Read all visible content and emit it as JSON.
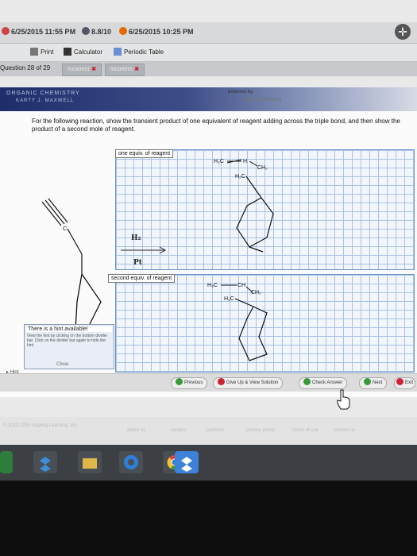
{
  "tabs": {
    "first_date": "6/25/2015 11:55 PM",
    "middle": "8.8/10",
    "second_date": "6/25/2015 10:25 PM"
  },
  "toolbar": {
    "print": "Print",
    "calculator": "Calculator",
    "periodic_table": "Periodic Table"
  },
  "question": {
    "number": "Question 28 of 29",
    "tab_incorrect_1": "Incorrect",
    "tab_incorrect_2": "Incorrect"
  },
  "header": {
    "course_line1": "ORGANIC CHEMISTRY",
    "course_line2": "KARTY J. MAXWELL",
    "powered_by": "powered by",
    "brand": "sapling learning"
  },
  "prompt": "For the following reaction, show the transient product of one equivalent of reagent adding across the triple bond, and then show the product of a second mole of reagent.",
  "grid1": {
    "label": "one equiv. of reagent",
    "atoms": {
      "a": "H₃C",
      "b": "H",
      "c": "CH₂",
      "d": "H₂C"
    }
  },
  "grid2": {
    "label": "second equiv. of reagent",
    "atoms": {
      "a": "H₃C",
      "b": "CH",
      "c": "CH₂",
      "d": "H₂C"
    }
  },
  "reaction": {
    "reagent": "H₂",
    "catalyst": "Pt",
    "atom_label": "C"
  },
  "hint": {
    "title": "There is a hint available!",
    "text": "View the hint by clicking on the bottom divider bar. Click on the divider bar again to hide the hint.",
    "close": "Close",
    "bar_label": "Hint"
  },
  "nav": {
    "previous": "Previous",
    "give_up": "Give Up & View Solution",
    "check": "Check Answer",
    "next": "Next",
    "exit": "Exit"
  },
  "footer": {
    "copyright": "© 2011-2015 Sapling Learning, Inc.",
    "links": [
      "about us",
      "careers",
      "partners",
      "privacy policy",
      "terms of use",
      "contact us"
    ]
  },
  "colors": {
    "grid_line": "#a7c2e6",
    "header_blue": "#1e2e6a",
    "incorrect_red": "#cc2233",
    "check_green": "#3a9a3a"
  }
}
